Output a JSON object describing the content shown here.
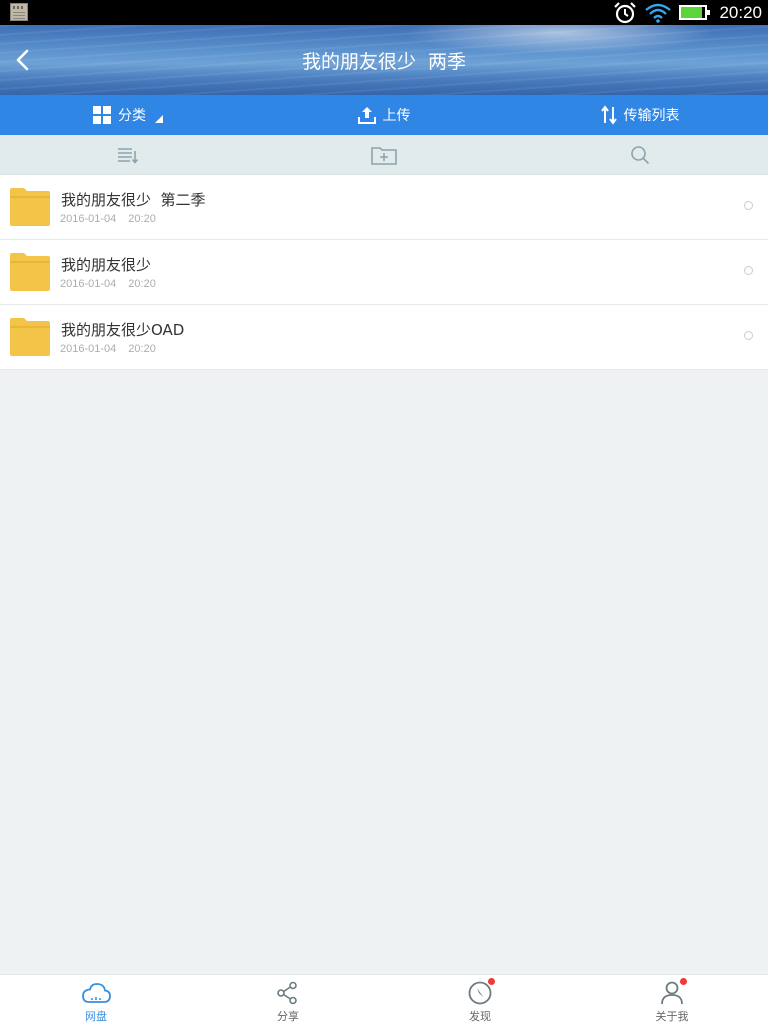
{
  "status_bar": {
    "time": "20:20",
    "battery_level": 0.85
  },
  "header": {
    "title": "我的朋友很少  两季"
  },
  "actions": {
    "category_label": "分类",
    "upload_label": "上传",
    "transfer_label": "传输列表"
  },
  "files": [
    {
      "name": "我的朋友很少  第二季",
      "date": "2016-01-04",
      "time": "20:20"
    },
    {
      "name": "我的朋友很少",
      "date": "2016-01-04",
      "time": "20:20"
    },
    {
      "name": "我的朋友很少OAD",
      "date": "2016-01-04",
      "time": "20:20"
    }
  ],
  "bottom_nav": {
    "items": [
      {
        "label": "网盘",
        "icon": "cloud-icon",
        "active": true,
        "badge": false
      },
      {
        "label": "分享",
        "icon": "share-icon",
        "active": false,
        "badge": false
      },
      {
        "label": "发现",
        "icon": "compass-icon",
        "active": false,
        "badge": true
      },
      {
        "label": "关于我",
        "icon": "person-icon",
        "active": false,
        "badge": true
      }
    ]
  },
  "colors": {
    "action_bar": "#2f86e4",
    "tool_bar": "#e1ebec",
    "folder": "#f3c448",
    "active_tab": "#3a8fe0",
    "badge": "#ef3a35"
  }
}
